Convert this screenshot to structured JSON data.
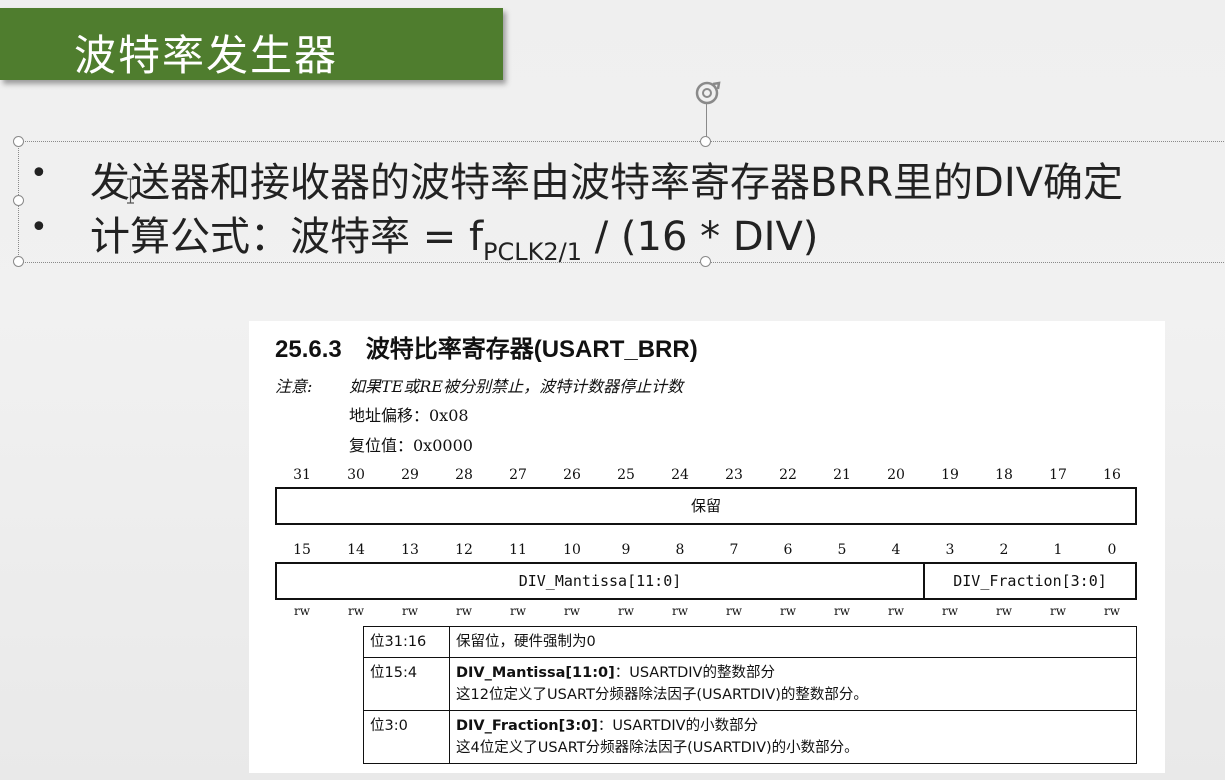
{
  "slide": {
    "title": "波特率发生器",
    "bullets": [
      {
        "text": "发送器和接收器的波特率由波特率寄存器BRR里的DIV确定"
      },
      {
        "prefix": "计算公式：波特率 = f",
        "subscript": "PCLK2/1",
        "suffix": " / (16 * DIV)"
      }
    ],
    "bullet_symbol": "•"
  },
  "sheet": {
    "section_title": "25.6.3  波特比率寄存器(USART_BRR)",
    "note_label": "注意:",
    "note_text": "如果TE或RE被分别禁止，波特计数器停止计数",
    "address_offset": "地址偏移：0x08",
    "reset_value": "复位值：0x0000",
    "high_bits": [
      "31",
      "30",
      "29",
      "28",
      "27",
      "26",
      "25",
      "24",
      "23",
      "22",
      "21",
      "20",
      "19",
      "18",
      "17",
      "16"
    ],
    "low_bits": [
      "15",
      "14",
      "13",
      "12",
      "11",
      "10",
      "9",
      "8",
      "7",
      "6",
      "5",
      "4",
      "3",
      "2",
      "1",
      "0"
    ],
    "reserved_label": "保留",
    "mantissa_label": "DIV_Mantissa[11:0]",
    "fraction_label": "DIV_Fraction[3:0]",
    "rw_label": "rw",
    "rows": [
      {
        "bits": "位31:16",
        "line1_bold": "",
        "line1": "保留位，硬件强制为0",
        "line2": ""
      },
      {
        "bits": "位15:4",
        "line1_bold": "DIV_Mantissa[11:0]",
        "line1": "：USARTDIV的整数部分",
        "line2": "这12位定义了USART分频器除法因子(USARTDIV)的整数部分。"
      },
      {
        "bits": "位3:0",
        "line1_bold": "DIV_Fraction[3:0]",
        "line1": "：USARTDIV的小数部分",
        "line2": "这4位定义了USART分频器除法因子(USARTDIV)的小数部分。"
      }
    ]
  },
  "colors": {
    "title_bar": "#4f7d2e",
    "handle": "#8a8a8a"
  },
  "icons": {
    "rotate": "rotate-handle-icon",
    "cursor": "text-cursor-icon"
  }
}
